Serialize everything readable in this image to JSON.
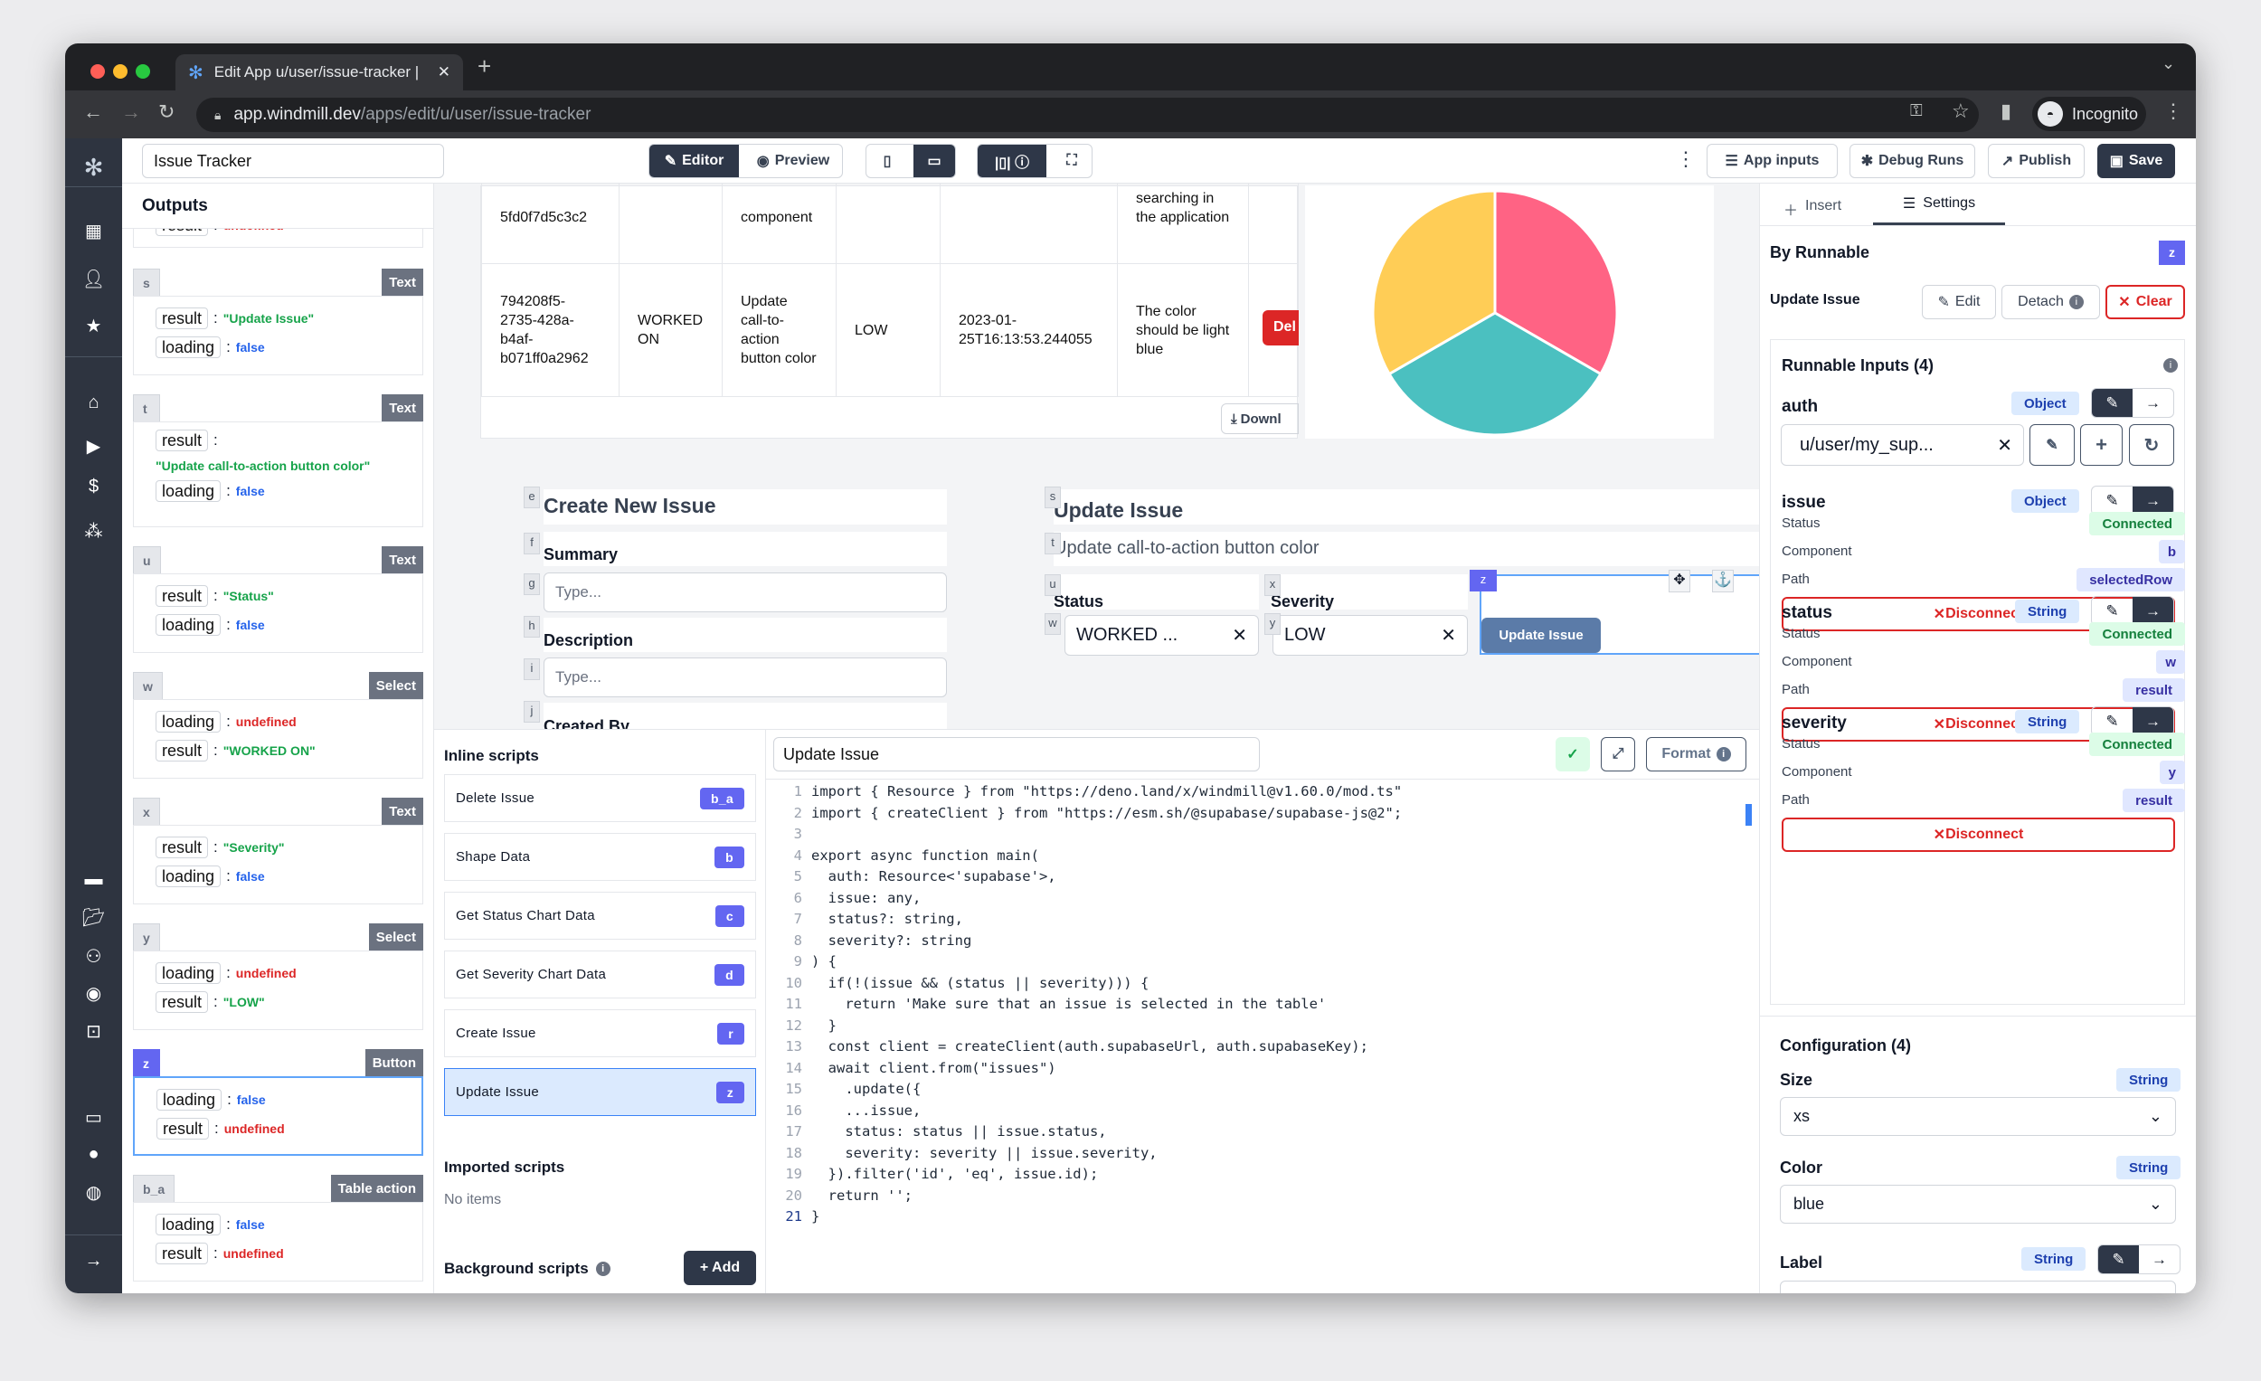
{
  "browser": {
    "tab_title": "Edit App u/user/issue-tracker |",
    "url_host": "app.windmill.dev",
    "url_path": "/apps/edit/u/user/issue-tracker",
    "profile": "Incognito"
  },
  "header": {
    "app_name": "Issue Tracker",
    "editor": "Editor",
    "preview": "Preview",
    "app_inputs": "App inputs",
    "debug_runs": "Debug Runs",
    "publish": "Publish",
    "save": "Save"
  },
  "outputs": {
    "title": "Outputs",
    "partial": {
      "key": "result",
      "value": "undefined"
    },
    "cards": [
      {
        "id": "s",
        "type": "Text",
        "rows": [
          {
            "key": "result",
            "value": "\"Update Issue\"",
            "kind": "str"
          },
          {
            "key": "loading",
            "value": "false",
            "kind": "bool"
          }
        ]
      },
      {
        "id": "t",
        "type": "Text",
        "rows": [
          {
            "key": "result",
            "value": "\"Update call-to-action button color\"",
            "kind": "str",
            "wrap": true
          },
          {
            "key": "loading",
            "value": "false",
            "kind": "bool"
          }
        ]
      },
      {
        "id": "u",
        "type": "Text",
        "rows": [
          {
            "key": "result",
            "value": "\"Status\"",
            "kind": "str"
          },
          {
            "key": "loading",
            "value": "false",
            "kind": "bool"
          }
        ]
      },
      {
        "id": "w",
        "type": "Select",
        "rows": [
          {
            "key": "loading",
            "value": "undefined",
            "kind": "undef"
          },
          {
            "key": "result",
            "value": "\"WORKED ON\"",
            "kind": "str"
          }
        ]
      },
      {
        "id": "x",
        "type": "Text",
        "rows": [
          {
            "key": "result",
            "value": "\"Severity\"",
            "kind": "str"
          },
          {
            "key": "loading",
            "value": "false",
            "kind": "bool"
          }
        ]
      },
      {
        "id": "y",
        "type": "Select",
        "rows": [
          {
            "key": "loading",
            "value": "undefined",
            "kind": "undef"
          },
          {
            "key": "result",
            "value": "\"LOW\"",
            "kind": "str"
          }
        ]
      },
      {
        "id": "z",
        "type": "Button",
        "selected": true,
        "rows": [
          {
            "key": "loading",
            "value": "false",
            "kind": "bool"
          },
          {
            "key": "result",
            "value": "undefined",
            "kind": "undef"
          }
        ]
      },
      {
        "id": "b_a",
        "type": "Table action",
        "rows": [
          {
            "key": "loading",
            "value": "false",
            "kind": "bool"
          },
          {
            "key": "result",
            "value": "undefined",
            "kind": "undef"
          }
        ]
      }
    ]
  },
  "canvas": {
    "table": {
      "row1": [
        "5fd0f7d5c3c2",
        "",
        "component",
        "",
        "",
        "searching in the application"
      ],
      "row2": [
        "794208f5-2735-428a-b4af-b071ff0a2962",
        "WORKED ON",
        "Update call-to-action button color",
        "LOW",
        "2023-01-25T16:13:53.244055",
        "The color should be light blue"
      ],
      "delete_label": "Del",
      "download_label": "Downl"
    },
    "pie": {
      "values": [
        1,
        1,
        1
      ],
      "colors": [
        "#ff6384",
        "#4bc0c0",
        "#ffcd56"
      ]
    },
    "create_form": {
      "title": "Create New Issue",
      "title_id": "e",
      "summary_label": "Summary",
      "summary_id": "f",
      "summary_placeholder": "Type...",
      "summary_input_id": "g",
      "description_label": "Description",
      "description_id": "h",
      "description_placeholder": "Type...",
      "description_input_id": "i",
      "created_by_label": "Created By",
      "created_by_id": "j"
    },
    "update_form": {
      "title": "Update Issue",
      "title_id": "s",
      "summary": "Update call-to-action button color",
      "summary_id": "t",
      "status_label": "Status",
      "status_label_id": "u",
      "severity_label": "Severity",
      "severity_label_id": "x",
      "status_value": "WORKED ...",
      "status_select_id": "w",
      "severity_value": "LOW",
      "severity_select_id": "y",
      "button_label": "Update Issue",
      "button_id": "z"
    }
  },
  "scripts": {
    "inline_title": "Inline scripts",
    "items": [
      {
        "name": "Delete Issue",
        "id": "b_a"
      },
      {
        "name": "Shape Data",
        "id": "b"
      },
      {
        "name": "Get Status Chart Data",
        "id": "c"
      },
      {
        "name": "Get Severity Chart Data",
        "id": "d"
      },
      {
        "name": "Create Issue",
        "id": "r"
      },
      {
        "name": "Update Issue",
        "id": "z",
        "selected": true
      }
    ],
    "imported_title": "Imported scripts",
    "imported_empty": "No items",
    "background_title": "Background scripts",
    "add_label": "+ Add"
  },
  "editor": {
    "script_name": "Update Issue",
    "format_label": "Format",
    "lines": [
      "import { Resource } from \"https://deno.land/x/windmill@v1.60.0/mod.ts\"",
      "import { createClient } from \"https://esm.sh/@supabase/supabase-js@2\";",
      "",
      "export async function main(",
      "  auth: Resource<'supabase'>,",
      "  issue: any,",
      "  status?: string,",
      "  severity?: string",
      ") {",
      "  if(!(issue && (status || severity))) {",
      "    return 'Make sure that an issue is selected in the table'",
      "  }",
      "  const client = createClient(auth.supabaseUrl, auth.supabaseKey);",
      "  await client.from(\"issues\")",
      "    .update({",
      "    ...issue,",
      "    status: status || issue.status,",
      "    severity: severity || issue.severity,",
      "  }).filter('id', 'eq', issue.id);",
      "  return '';",
      "}"
    ]
  },
  "settings": {
    "tab_insert": "Insert",
    "tab_settings": "Settings",
    "by_runnable": "By Runnable",
    "component_id": "z",
    "runnable_name": "Update Issue",
    "edit": "Edit",
    "detach": "Detach",
    "clear": "Clear",
    "inputs_title": "Runnable Inputs (4)",
    "auth": {
      "name": "auth",
      "type": "Object",
      "value": "u/user/my_sup..."
    },
    "status_label": "Status",
    "component_label": "Component",
    "path_label": "Path",
    "disconnect": "Disconnect",
    "connected": [
      {
        "name": "issue",
        "type": "Object",
        "status": "Connected",
        "component": "b",
        "path": "selectedRow"
      },
      {
        "name": "status",
        "type": "String",
        "status": "Connected",
        "component": "w",
        "path": "result"
      },
      {
        "name": "severity",
        "type": "String",
        "status": "Connected",
        "component": "y",
        "path": "result"
      }
    ],
    "config_title": "Configuration (4)",
    "size": {
      "label": "Size",
      "type": "String",
      "value": "xs"
    },
    "color": {
      "label": "Color",
      "type": "String",
      "value": "blue"
    },
    "label": {
      "label": "Label",
      "type": "String"
    }
  }
}
